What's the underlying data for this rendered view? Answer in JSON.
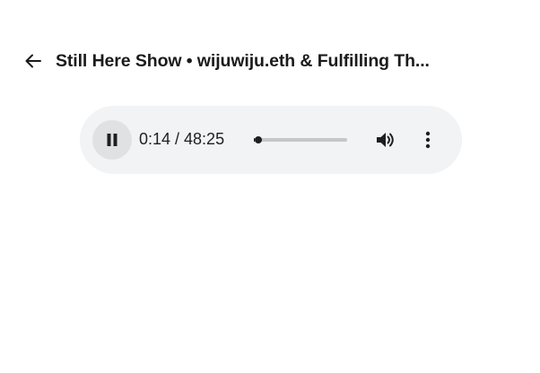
{
  "header": {
    "back_icon": "arrow-left-icon",
    "title": "Still Here Show • wijuwiju.eth & Fulfilling Th..."
  },
  "player": {
    "state": "playing",
    "control_icon": "pause-icon",
    "current_time": "0:14",
    "duration": "48:25",
    "time_display": "0:14 / 48:25",
    "progress_fraction": 0.005,
    "volume_icon": "volume-icon",
    "more_icon": "more-vertical-icon",
    "colors": {
      "background": "#f1f3f4",
      "button_background": "#dfe1e3",
      "track": "#c4c6c8",
      "foreground": "#1f1f1f"
    }
  }
}
